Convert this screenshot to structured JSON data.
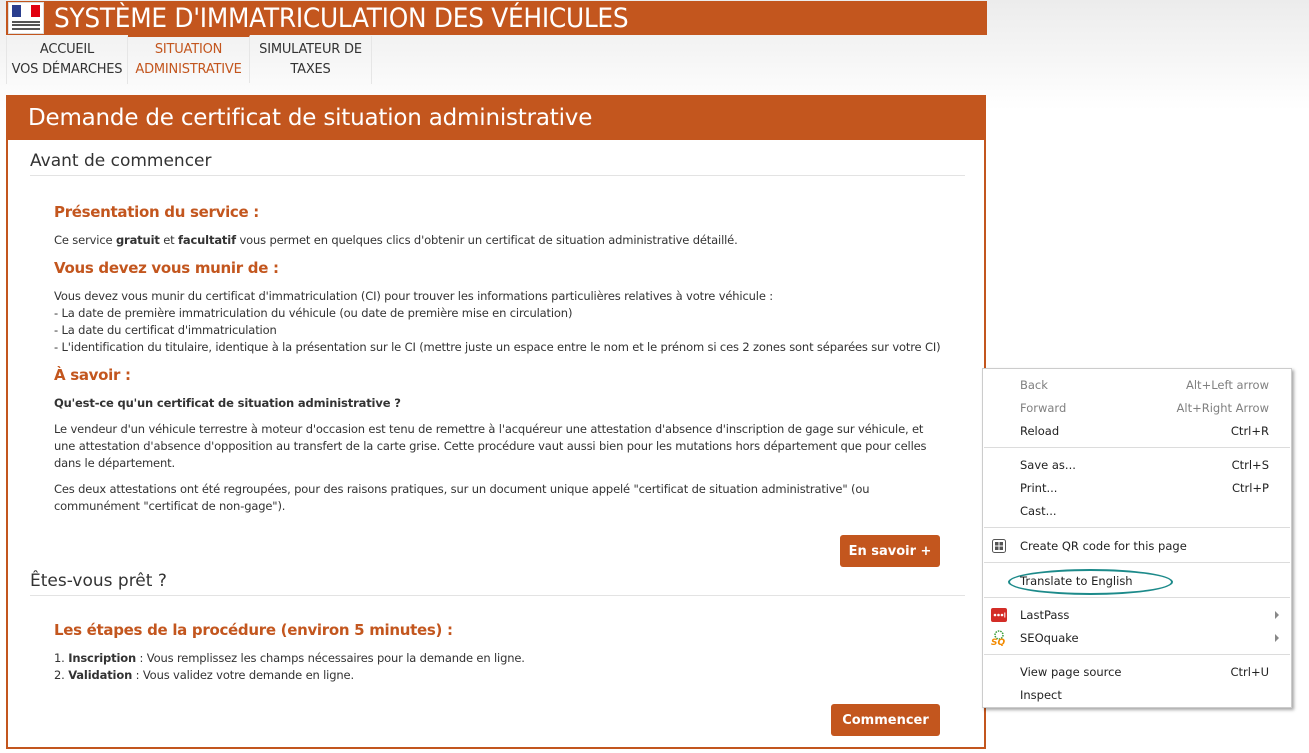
{
  "header": {
    "logo_alt": "Agence Nationale des Titres Sécurisés",
    "title": "SYSTÈME D'IMMATRICULATION DES VÉHICULES"
  },
  "nav": [
    {
      "line1": "ACCUEIL",
      "line2": "VOS DÉMARCHES",
      "active": false
    },
    {
      "line1": "SITUATION",
      "line2": "ADMINISTRATIVE",
      "active": true
    },
    {
      "line1": "SIMULATEUR DE",
      "line2": "TAXES",
      "active": false
    }
  ],
  "panel": {
    "title": "Demande de certificat de situation administrative",
    "section1": {
      "title": "Avant de commencer",
      "presentation": {
        "heading": "Présentation du service :",
        "pre": "Ce service ",
        "bold1": "gratuit",
        "mid": " et ",
        "bold2": "facultatif",
        "post": " vous permet en quelques clics d'obtenir un certificat de situation administrative détaillé."
      },
      "munir": {
        "heading": "Vous devez vous munir de :",
        "lines": [
          "Vous devez vous munir du certificat d'immatriculation (CI) pour trouver les informations particulières relatives à votre véhicule :",
          "- La date de première immatriculation du véhicule (ou date de première mise en circulation)",
          "- La date du certificat d'immatriculation",
          "- L'identification du titulaire, identique à la présentation sur le CI (mettre juste un espace entre le nom et le prénom si ces 2 zones sont séparées sur votre CI)"
        ]
      },
      "savoir": {
        "heading": "À savoir :",
        "question": "Qu'est-ce qu'un certificat de situation administrative ?",
        "para1": "Le vendeur d'un véhicule terrestre à moteur d'occasion est tenu de remettre à l'acquéreur une attestation d'absence d'inscription de gage sur véhicule, et une attestation d'absence d'opposition au transfert de la carte grise. Cette procédure vaut aussi bien pour les mutations hors département que pour celles dans le département.",
        "para2": "Ces deux attestations ont été regroupées, pour des raisons pratiques, sur un document unique appelé \"certificat de situation administrative\" (ou communément \"certificat de non-gage\")."
      },
      "more_button": "En savoir +"
    },
    "section2": {
      "title": "Êtes-vous prêt ?",
      "steps_heading": "Les étapes de la procédure (environ 5 minutes) :",
      "steps": [
        {
          "num": "1. ",
          "bold": "Inscription",
          "text": " : Vous remplissez les champs nécessaires pour la demande en ligne."
        },
        {
          "num": "2. ",
          "bold": "Validation",
          "text": " : Vous validez votre demande en ligne."
        }
      ],
      "start_button": "Commencer"
    }
  },
  "context_menu": {
    "items": [
      {
        "label": "Back",
        "shortcut": "Alt+Left arrow",
        "disabled": true
      },
      {
        "label": "Forward",
        "shortcut": "Alt+Right Arrow",
        "disabled": true
      },
      {
        "label": "Reload",
        "shortcut": "Ctrl+R",
        "disabled": false
      },
      {
        "label": "Save as...",
        "shortcut": "Ctrl+S",
        "disabled": false
      },
      {
        "label": "Print...",
        "shortcut": "Ctrl+P",
        "disabled": false
      },
      {
        "label": "Cast...",
        "shortcut": "",
        "disabled": false
      },
      {
        "label": "Create QR code for this page",
        "shortcut": "",
        "icon": "qr-code-icon"
      },
      {
        "label": "Translate to English",
        "shortcut": "",
        "highlighted": true
      },
      {
        "label": "LastPass",
        "shortcut": "",
        "icon": "lastpass-icon",
        "submenu": true
      },
      {
        "label": "SEOquake",
        "shortcut": "",
        "icon": "seoquake-icon",
        "submenu": true
      },
      {
        "label": "View page source",
        "shortcut": "Ctrl+U",
        "disabled": false
      },
      {
        "label": "Inspect",
        "shortcut": "",
        "disabled": false
      }
    ],
    "highlight_color": "#1c8a8a"
  },
  "colors": {
    "brand": "#c3561e",
    "lastpass": "#d32d27"
  }
}
